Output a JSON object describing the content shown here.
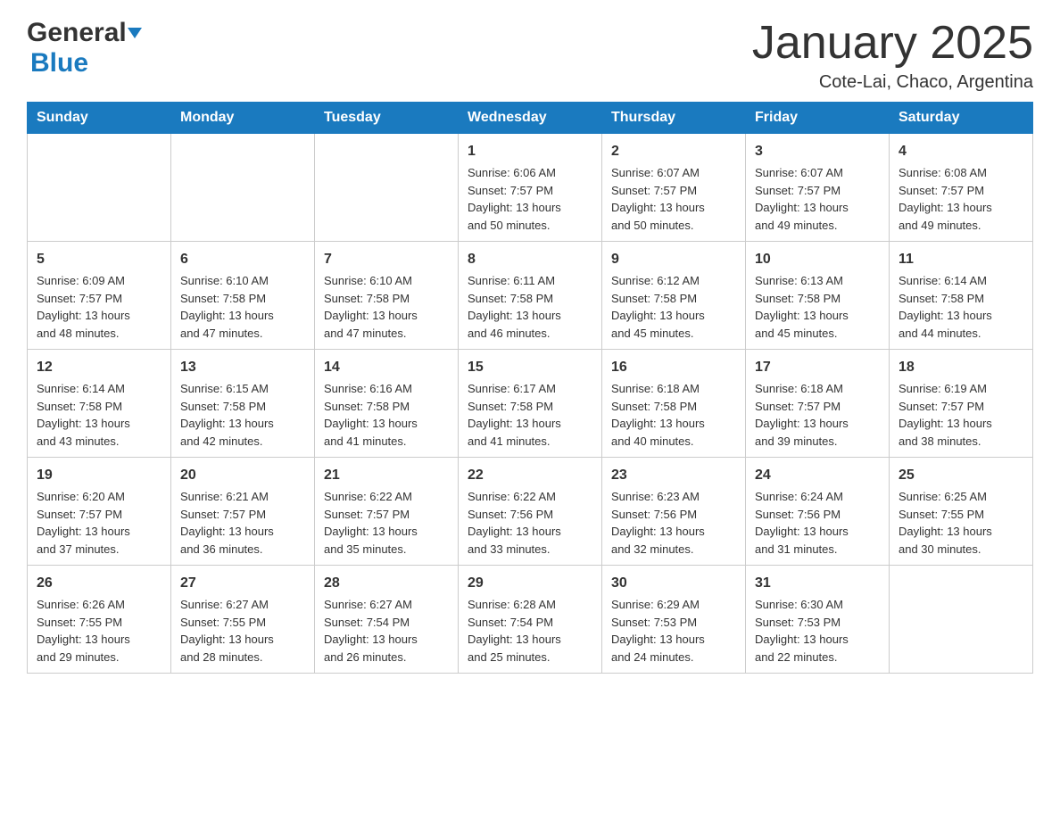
{
  "header": {
    "logo_general": "General",
    "logo_blue": "Blue",
    "title": "January 2025",
    "subtitle": "Cote-Lai, Chaco, Argentina"
  },
  "days": [
    "Sunday",
    "Monday",
    "Tuesday",
    "Wednesday",
    "Thursday",
    "Friday",
    "Saturday"
  ],
  "weeks": [
    [
      {
        "date": "",
        "info": ""
      },
      {
        "date": "",
        "info": ""
      },
      {
        "date": "",
        "info": ""
      },
      {
        "date": "1",
        "info": "Sunrise: 6:06 AM\nSunset: 7:57 PM\nDaylight: 13 hours\nand 50 minutes."
      },
      {
        "date": "2",
        "info": "Sunrise: 6:07 AM\nSunset: 7:57 PM\nDaylight: 13 hours\nand 50 minutes."
      },
      {
        "date": "3",
        "info": "Sunrise: 6:07 AM\nSunset: 7:57 PM\nDaylight: 13 hours\nand 49 minutes."
      },
      {
        "date": "4",
        "info": "Sunrise: 6:08 AM\nSunset: 7:57 PM\nDaylight: 13 hours\nand 49 minutes."
      }
    ],
    [
      {
        "date": "5",
        "info": "Sunrise: 6:09 AM\nSunset: 7:57 PM\nDaylight: 13 hours\nand 48 minutes."
      },
      {
        "date": "6",
        "info": "Sunrise: 6:10 AM\nSunset: 7:58 PM\nDaylight: 13 hours\nand 47 minutes."
      },
      {
        "date": "7",
        "info": "Sunrise: 6:10 AM\nSunset: 7:58 PM\nDaylight: 13 hours\nand 47 minutes."
      },
      {
        "date": "8",
        "info": "Sunrise: 6:11 AM\nSunset: 7:58 PM\nDaylight: 13 hours\nand 46 minutes."
      },
      {
        "date": "9",
        "info": "Sunrise: 6:12 AM\nSunset: 7:58 PM\nDaylight: 13 hours\nand 45 minutes."
      },
      {
        "date": "10",
        "info": "Sunrise: 6:13 AM\nSunset: 7:58 PM\nDaylight: 13 hours\nand 45 minutes."
      },
      {
        "date": "11",
        "info": "Sunrise: 6:14 AM\nSunset: 7:58 PM\nDaylight: 13 hours\nand 44 minutes."
      }
    ],
    [
      {
        "date": "12",
        "info": "Sunrise: 6:14 AM\nSunset: 7:58 PM\nDaylight: 13 hours\nand 43 minutes."
      },
      {
        "date": "13",
        "info": "Sunrise: 6:15 AM\nSunset: 7:58 PM\nDaylight: 13 hours\nand 42 minutes."
      },
      {
        "date": "14",
        "info": "Sunrise: 6:16 AM\nSunset: 7:58 PM\nDaylight: 13 hours\nand 41 minutes."
      },
      {
        "date": "15",
        "info": "Sunrise: 6:17 AM\nSunset: 7:58 PM\nDaylight: 13 hours\nand 41 minutes."
      },
      {
        "date": "16",
        "info": "Sunrise: 6:18 AM\nSunset: 7:58 PM\nDaylight: 13 hours\nand 40 minutes."
      },
      {
        "date": "17",
        "info": "Sunrise: 6:18 AM\nSunset: 7:57 PM\nDaylight: 13 hours\nand 39 minutes."
      },
      {
        "date": "18",
        "info": "Sunrise: 6:19 AM\nSunset: 7:57 PM\nDaylight: 13 hours\nand 38 minutes."
      }
    ],
    [
      {
        "date": "19",
        "info": "Sunrise: 6:20 AM\nSunset: 7:57 PM\nDaylight: 13 hours\nand 37 minutes."
      },
      {
        "date": "20",
        "info": "Sunrise: 6:21 AM\nSunset: 7:57 PM\nDaylight: 13 hours\nand 36 minutes."
      },
      {
        "date": "21",
        "info": "Sunrise: 6:22 AM\nSunset: 7:57 PM\nDaylight: 13 hours\nand 35 minutes."
      },
      {
        "date": "22",
        "info": "Sunrise: 6:22 AM\nSunset: 7:56 PM\nDaylight: 13 hours\nand 33 minutes."
      },
      {
        "date": "23",
        "info": "Sunrise: 6:23 AM\nSunset: 7:56 PM\nDaylight: 13 hours\nand 32 minutes."
      },
      {
        "date": "24",
        "info": "Sunrise: 6:24 AM\nSunset: 7:56 PM\nDaylight: 13 hours\nand 31 minutes."
      },
      {
        "date": "25",
        "info": "Sunrise: 6:25 AM\nSunset: 7:55 PM\nDaylight: 13 hours\nand 30 minutes."
      }
    ],
    [
      {
        "date": "26",
        "info": "Sunrise: 6:26 AM\nSunset: 7:55 PM\nDaylight: 13 hours\nand 29 minutes."
      },
      {
        "date": "27",
        "info": "Sunrise: 6:27 AM\nSunset: 7:55 PM\nDaylight: 13 hours\nand 28 minutes."
      },
      {
        "date": "28",
        "info": "Sunrise: 6:27 AM\nSunset: 7:54 PM\nDaylight: 13 hours\nand 26 minutes."
      },
      {
        "date": "29",
        "info": "Sunrise: 6:28 AM\nSunset: 7:54 PM\nDaylight: 13 hours\nand 25 minutes."
      },
      {
        "date": "30",
        "info": "Sunrise: 6:29 AM\nSunset: 7:53 PM\nDaylight: 13 hours\nand 24 minutes."
      },
      {
        "date": "31",
        "info": "Sunrise: 6:30 AM\nSunset: 7:53 PM\nDaylight: 13 hours\nand 22 minutes."
      },
      {
        "date": "",
        "info": ""
      }
    ]
  ]
}
